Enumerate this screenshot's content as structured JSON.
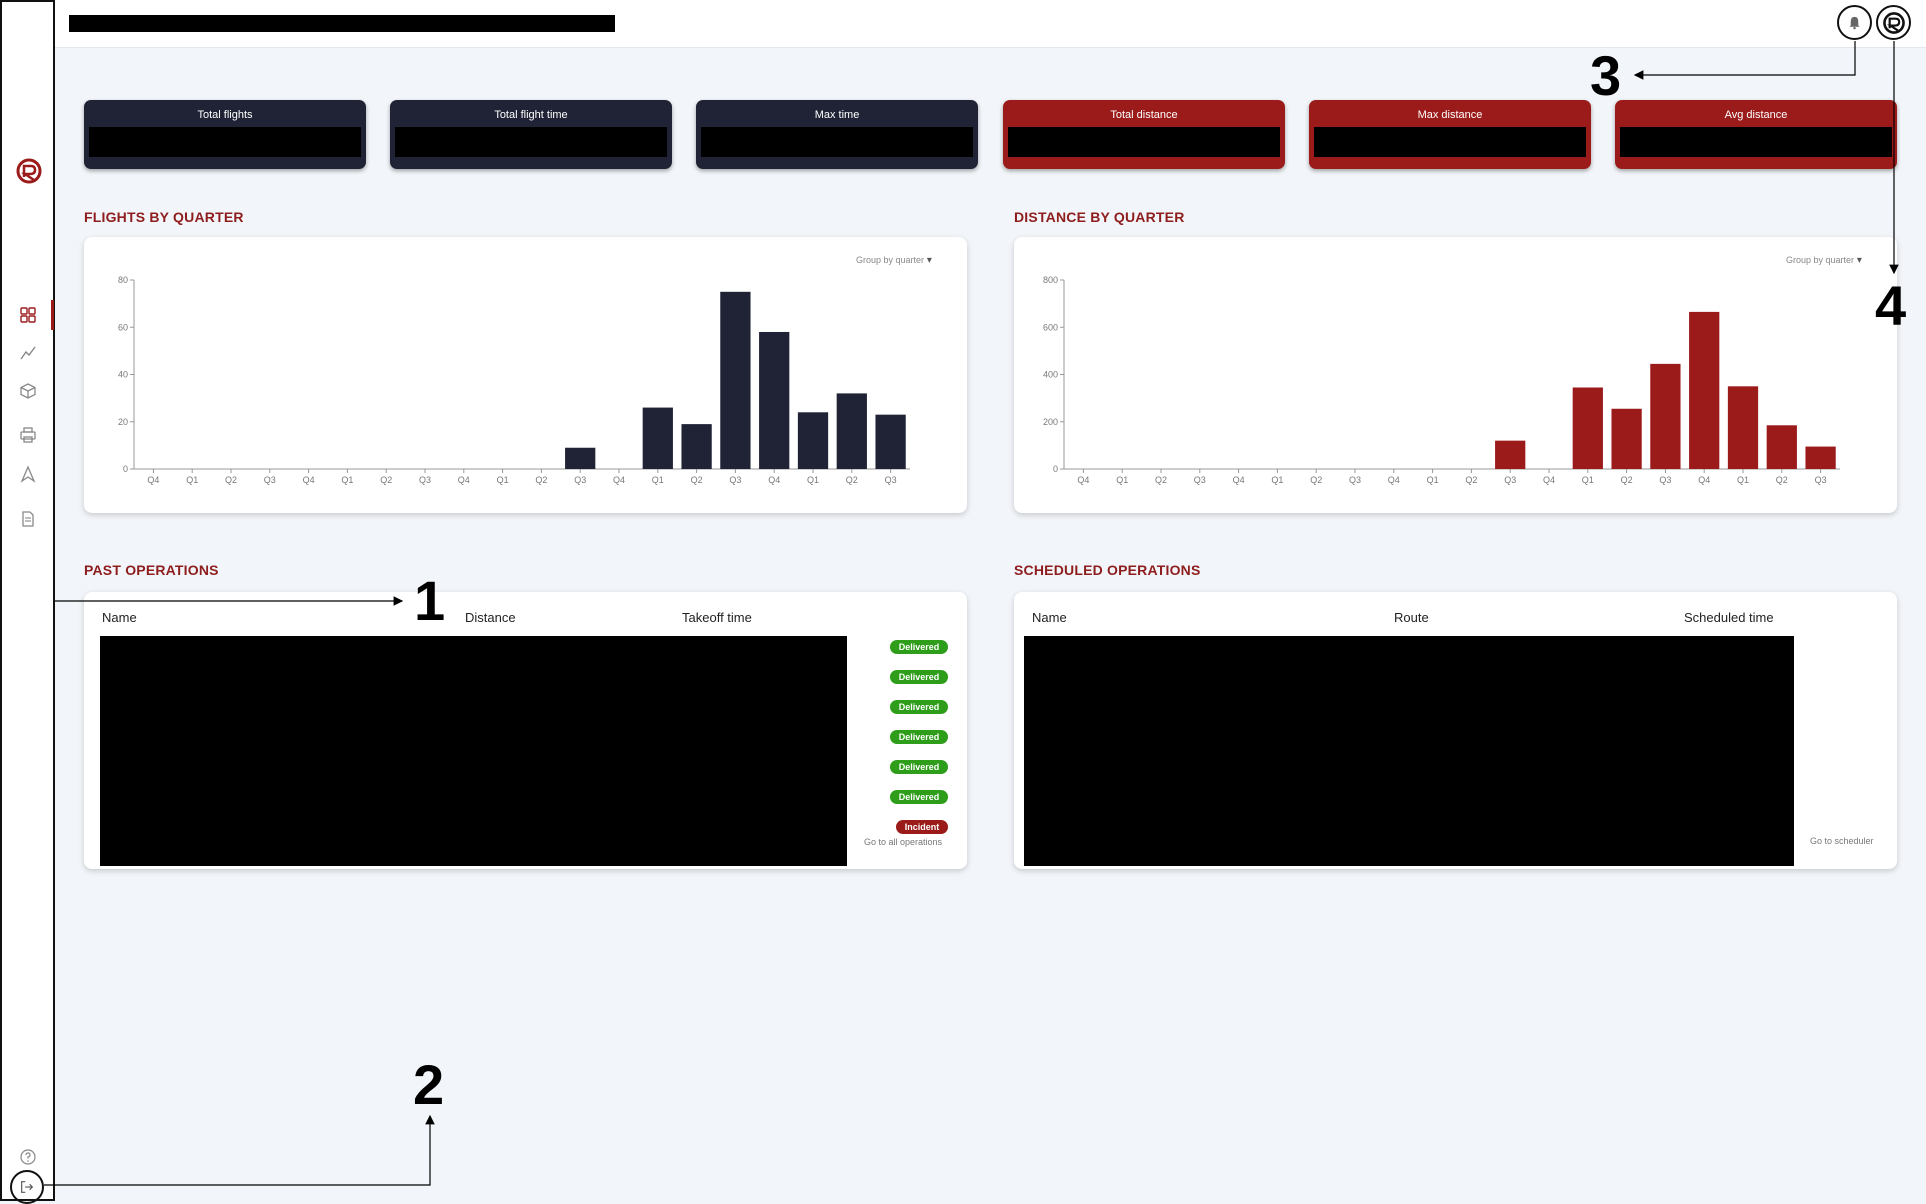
{
  "kpis": [
    {
      "label": "Total flights",
      "color": "#1f2335"
    },
    {
      "label": "Total flight time",
      "color": "#1f2335"
    },
    {
      "label": "Max time",
      "color": "#1f2335"
    },
    {
      "label": "Total distance",
      "color": "#9b1b1b"
    },
    {
      "label": "Max distance",
      "color": "#9b1b1b"
    },
    {
      "label": "Avg distance",
      "color": "#9b1b1b"
    }
  ],
  "flights_section": {
    "title": "FLIGHTS BY QUARTER",
    "group_by": "Group by quarter"
  },
  "distance_section": {
    "title": "DISTANCE BY QUARTER",
    "group_by": "Group by quarter"
  },
  "past_ops": {
    "title": "PAST OPERATIONS",
    "columns": [
      "Name",
      "Distance",
      "Takeoff time"
    ],
    "statuses": [
      "Delivered",
      "Delivered",
      "Delivered",
      "Delivered",
      "Delivered",
      "Delivered",
      "Incident"
    ],
    "link": "Go to all operations"
  },
  "scheduled_ops": {
    "title": "SCHEDULED OPERATIONS",
    "columns": [
      "Name",
      "Route",
      "Scheduled time"
    ],
    "link": "Go to scheduler"
  },
  "markers": [
    "1",
    "2",
    "3",
    "4"
  ],
  "colors": {
    "accent": "#9b1b1b",
    "navy": "#1f2335",
    "success": "#2e9d1a"
  },
  "icons": {
    "sidebar": [
      "brand-logo-icon",
      "dashboard-icon",
      "analytics-icon",
      "package-icon",
      "printer-icon",
      "drone-icon",
      "document-icon",
      "help-icon",
      "logout-icon"
    ],
    "topbar": [
      "bell-icon",
      "profile-logo-icon"
    ]
  },
  "chart_data": [
    {
      "type": "bar",
      "categories": [
        "Q4",
        "Q1",
        "Q2",
        "Q3",
        "Q4",
        "Q1",
        "Q2",
        "Q3",
        "Q4",
        "Q1",
        "Q2",
        "Q3",
        "Q4",
        "Q1",
        "Q2",
        "Q3",
        "Q4",
        "Q1",
        "Q2",
        "Q3"
      ],
      "values": [
        0,
        0,
        0,
        0,
        0,
        0,
        0,
        0,
        0,
        0,
        0,
        9,
        0,
        26,
        19,
        75,
        58,
        24,
        32,
        23
      ],
      "ylim": [
        0,
        80
      ],
      "yticks": [
        "0",
        "20",
        "40",
        "60",
        "80"
      ],
      "color": "#1f2335",
      "grid": false
    },
    {
      "type": "bar",
      "categories": [
        "Q4",
        "Q1",
        "Q2",
        "Q3",
        "Q4",
        "Q1",
        "Q2",
        "Q3",
        "Q4",
        "Q1",
        "Q2",
        "Q3",
        "Q4",
        "Q1",
        "Q2",
        "Q3",
        "Q4",
        "Q1",
        "Q2",
        "Q3"
      ],
      "values": [
        0,
        0,
        0,
        0,
        0,
        0,
        0,
        0,
        0,
        0,
        0,
        120,
        0,
        345,
        255,
        445,
        665,
        350,
        185,
        95
      ],
      "ylim": [
        0,
        800
      ],
      "yticks": [
        "0",
        "200",
        "400",
        "600",
        "800"
      ],
      "color": "#9b1b1b",
      "grid": false
    }
  ]
}
